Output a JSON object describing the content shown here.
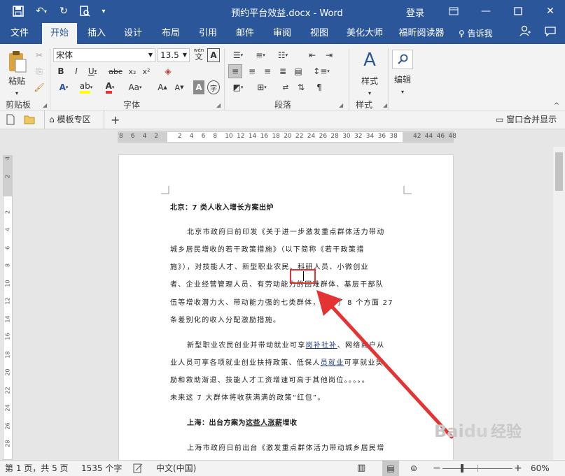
{
  "window": {
    "title": "预约平台效益.docx - Word",
    "login": "登录"
  },
  "tabs": [
    "文件",
    "开始",
    "插入",
    "设计",
    "布局",
    "引用",
    "邮件",
    "审阅",
    "视图",
    "美化大师",
    "福昕阅读器"
  ],
  "tellme": "告诉我",
  "clipboard": {
    "paste": "粘贴",
    "label": "剪贴板"
  },
  "font": {
    "name": "宋体",
    "size": "13.5",
    "label": "字体",
    "wen": "wén",
    "wen_char": "文"
  },
  "paragraph": {
    "label": "段落"
  },
  "styles": {
    "button": "样式",
    "label": "样式"
  },
  "editing": {
    "button": "编辑"
  },
  "navbar": {
    "template_zone": "模板专区",
    "window_merge": "窗口合并显示"
  },
  "hruler": [
    "8",
    "6",
    "4",
    "2",
    "",
    "2",
    "4",
    "6",
    "8",
    "10",
    "12",
    "14",
    "16",
    "18",
    "20",
    "22",
    "24",
    "26",
    "28",
    "30",
    "32",
    "34",
    "36",
    "38",
    "",
    "42",
    "44",
    "46",
    "48"
  ],
  "vruler": [
    "4",
    "2",
    "",
    "2",
    "4",
    "6",
    "8",
    "10",
    "12",
    "14",
    "16",
    "18",
    "20",
    "22",
    "24",
    "26",
    "28"
  ],
  "document": {
    "h1": "北京：7 类人收入增长方案出炉",
    "p1": [
      "北京市政府日前印发《关于进一步激发重点群体活力带动",
      "城乡居民增收的若干政策措施》（以下简称《若干政策措",
      "施》），对技能人才、新型职业农民、科研人员、小微创业",
      "者、企业经营管理人员、有劳动能力的困难群体、基层干部队",
      "伍等增收潜力大、带动能力强的七类群体，推出了 8 个方面 27",
      "条差别化的收入分配激励措施。"
    ],
    "p2_l1a": "新型职业农民创业并带动就业可享",
    "p2_l1u": "岗补社补",
    "p2_l1b": "、网络商户从",
    "p2_l2a": "业人员可享各项就业创业扶持政策、低保人",
    "p2_l2u": "员就业",
    "p2_l2b": "可享就业奖",
    "p2_l3": "励和救助渐退、技能人才工资增速可高于其他岗位。。。。。",
    "p2_l4": "未来这 7 大群体将收获满满的政策“红包”。",
    "h2a": "上海：出台方案为",
    "h2u": "这些人涨薪",
    "h2b": "增收",
    "p3": "上海市政府日前出台《激发重点群体活力带动城乡居民增"
  },
  "status": {
    "page": "第 1 页，共 5 页",
    "words": "1535 个字",
    "lang": "中文(中国)",
    "zoom": "60%"
  },
  "watermark": {
    "brand": "Bai",
    "paw": "du",
    "suffix": "经验"
  },
  "colors": {
    "accent": "#2b579a",
    "highlight": "#e53333",
    "arrow": "#e53333"
  }
}
